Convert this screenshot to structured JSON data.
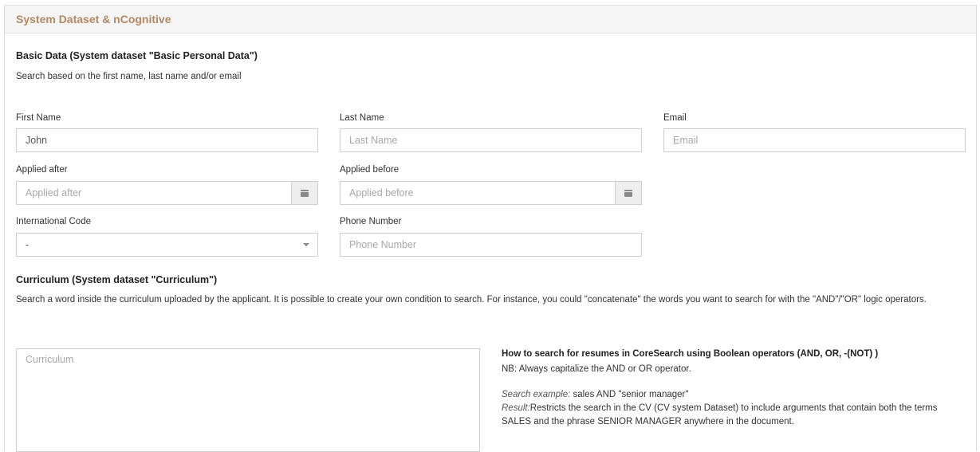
{
  "panel": {
    "title": "System Dataset & nCognitive"
  },
  "basic": {
    "title": "Basic Data (System dataset \"Basic Personal Data\")",
    "description": "Search based on the first name, last name and/or email",
    "first_name": {
      "label": "First Name",
      "value": "John",
      "placeholder": "First Name"
    },
    "last_name": {
      "label": "Last Name",
      "value": "",
      "placeholder": "Last Name"
    },
    "email": {
      "label": "Email",
      "value": "",
      "placeholder": "Email"
    },
    "applied_after": {
      "label": "Applied after",
      "value": "",
      "placeholder": "Applied after"
    },
    "applied_before": {
      "label": "Applied before",
      "value": "",
      "placeholder": "Applied before"
    },
    "intl_code": {
      "label": "International Code",
      "selected": "-"
    },
    "phone": {
      "label": "Phone Number",
      "value": "",
      "placeholder": "Phone Number"
    }
  },
  "curriculum": {
    "title": "Curriculum (System dataset \"Curriculum\")",
    "description": "Search a word inside the curriculum uploaded by the applicant. It is possible to create your own condition to search. For instance, you could \"concatenate\" the words you want to search for with the \"AND\"/\"OR\" logic operators.",
    "textarea": {
      "value": "",
      "placeholder": "Curriculum"
    }
  },
  "help": {
    "title": "How to search for resumes in CoreSearch using Boolean operators (AND, OR, -(NOT) )",
    "note": "NB: Always capitalize the AND or OR operator.",
    "example_label": "Search example:",
    "example_text": " sales AND \"senior manager\"",
    "result_label": "Result:",
    "result_text": "Restricts the search in the CV (CV system Dataset) to include arguments that contain both the terms SALES and the phrase SENIOR MANAGER anywhere in the document."
  },
  "icons": {
    "calendar": "calendar-icon",
    "dropdown": "chevron-down-icon"
  }
}
